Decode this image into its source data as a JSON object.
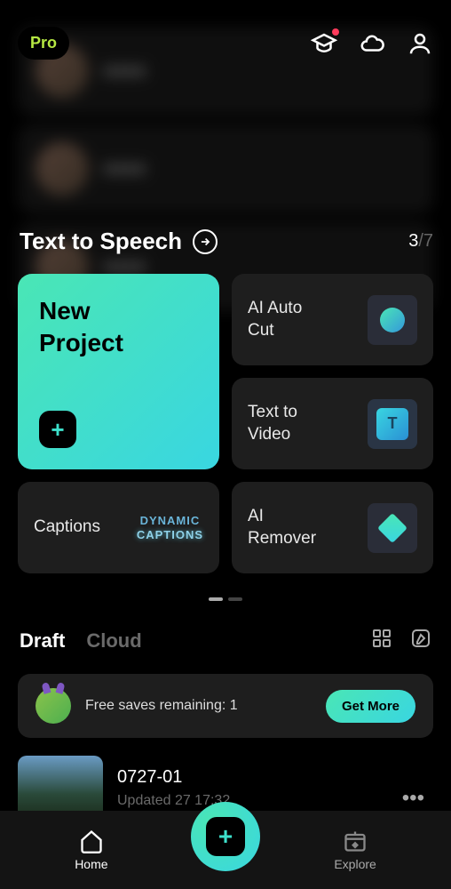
{
  "header": {
    "pro_label": "Pro"
  },
  "section": {
    "title": "Text to Speech",
    "current": "3",
    "total": "/7"
  },
  "tools": {
    "new_project": "New\nProject",
    "ai_auto_cut": "AI Auto\nCut",
    "text_to_video": "Text to\nVideo",
    "captions": "Captions",
    "ai_remover": "AI\nRemover",
    "dynamic_label1": "DYNAMIC",
    "dynamic_label2": "CAPTIONS"
  },
  "drafts": {
    "draft_tab": "Draft",
    "cloud_tab": "Cloud"
  },
  "promo": {
    "text": "Free saves remaining: 1",
    "button": "Get More"
  },
  "draft_item": {
    "name": "0727-01",
    "meta": "Updated          27 17:32"
  },
  "nav": {
    "home": "Home",
    "explore": "Explore"
  }
}
